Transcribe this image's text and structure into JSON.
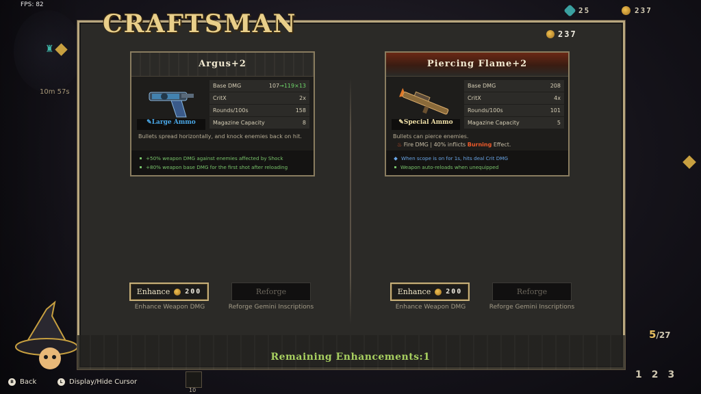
{
  "hud": {
    "fps": "FPS: 82",
    "timer": "10m 57s",
    "chips": "25",
    "coins_top": "237"
  },
  "panel": {
    "title": "CRAFTSMAN",
    "coins": "237",
    "remaining": "Remaining Enhancements:1"
  },
  "weapons": [
    {
      "name": "Argus+2",
      "ammo": "Large Ammo",
      "stats": [
        {
          "label": "Base DMG",
          "value": "107",
          "value_up": "119×13"
        },
        {
          "label": "CritX",
          "value": "2x"
        },
        {
          "label": "Rounds/100s",
          "value": "158"
        },
        {
          "label": "Magazine Capacity",
          "value": "8"
        }
      ],
      "desc": "Bullets spread horizontally, and knock enemies back on hit.",
      "bonuses": [
        "+50% weapon DMG against enemies affected by Shock",
        "+80% weapon base DMG for the first shot after reloading"
      ],
      "enhance_label": "Enhance",
      "enhance_cost": "200",
      "enhance_caption": "Enhance Weapon DMG",
      "reforge_label": "Reforge",
      "reforge_caption": "Reforge Gemini Inscriptions"
    },
    {
      "name": "Piercing Flame+2",
      "ammo": "Special Ammo",
      "stats": [
        {
          "label": "Base DMG",
          "value": "208"
        },
        {
          "label": "CritX",
          "value": "4x"
        },
        {
          "label": "Rounds/100s",
          "value": "101"
        },
        {
          "label": "Magazine Capacity",
          "value": "5"
        }
      ],
      "desc": "Bullets can pierce enemies.",
      "fire_pre": "Fire DMG | 40% inflicts ",
      "fire_burn": "Burning",
      "fire_post": " Effect.",
      "bonuses": [
        "When scope is on for 1s, hits deal Crit DMG",
        "Weapon auto-reloads when unequipped"
      ],
      "enhance_label": "Enhance",
      "enhance_cost": "200",
      "enhance_caption": "Enhance Weapon DMG",
      "reforge_label": "Reforge",
      "reforge_caption": "Reforge Gemini Inscriptions"
    }
  ],
  "footer": {
    "back_key": "B",
    "back": "Back",
    "cursor_key": "L",
    "cursor": "Display/Hide Cursor",
    "slot_count": "10"
  },
  "player": {
    "ammo_current": "5",
    "ammo_max": "/27",
    "weapon_slots": [
      "1",
      "2",
      "3"
    ]
  },
  "colors": {
    "accent_gold": "#e9cf8a",
    "remaining_green": "#a8d060",
    "large_ammo_blue": "#4aa8e8",
    "burning_red": "#ef5a2a"
  }
}
